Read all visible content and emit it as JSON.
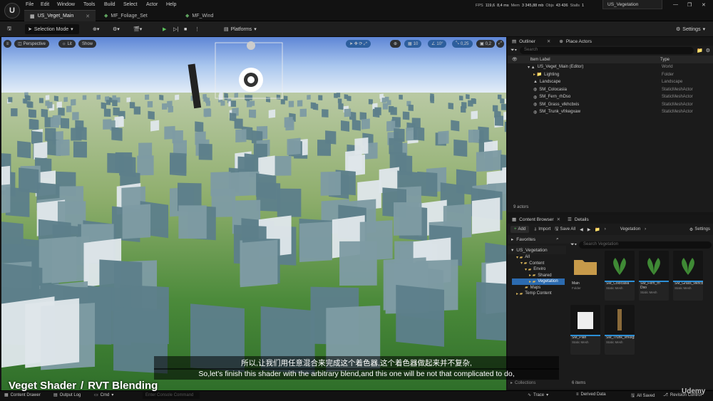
{
  "app": {
    "logo": "U",
    "menu": [
      "File",
      "Edit",
      "Window",
      "Tools",
      "Build",
      "Select",
      "Actor",
      "Help"
    ],
    "tabs": [
      "US_Veget_Main",
      "MF_Foliage_Set",
      "MF_Wind"
    ],
    "stats": {
      "fps_label": "FPS",
      "fps": "119,6",
      "ms": "8,4 ms",
      "mem_label": "Mem",
      "mem": "3 345,88 mb",
      "objs_label": "Objs",
      "objs": "43 436",
      "stalls_label": "Stalls",
      "stalls": "1"
    },
    "level_name": "US_Vegetation"
  },
  "toolbar": {
    "mode": "Selection Mode",
    "platforms": "Platforms",
    "settings": "Settings"
  },
  "viewport": {
    "perspective": "Perspective",
    "lit": "Lit",
    "show": "Show",
    "grid_snap": "10",
    "rot_snap": "10°",
    "scale_snap": "0,25",
    "cam_speed": "0,2"
  },
  "outliner": {
    "tab": "Outliner",
    "tab2": "Place Actors",
    "search_placeholder": "Search",
    "col_label": "Item Label",
    "col_type": "Type",
    "rows": [
      {
        "label": "US_Veget_Main (Editor)",
        "type": "World"
      },
      {
        "label": "Lighting",
        "type": "Folder"
      },
      {
        "label": "Landscape",
        "type": "Landscape"
      },
      {
        "label": "SM_Colocasia",
        "type": "StaticMeshActor"
      },
      {
        "label": "SM_Fern_rhDso",
        "type": "StaticMeshActor"
      },
      {
        "label": "SM_Grass_vlkhcbxis",
        "type": "StaticMeshActor"
      },
      {
        "label": "SM_Trunk_vfrkegxaw",
        "type": "StaticMeshActor"
      }
    ],
    "footer": "9 actors"
  },
  "content_browser": {
    "tab": "Content Browser",
    "tab2": "Details",
    "add": "Add",
    "import": "Import",
    "save_all": "Save All",
    "path": "Vegetation",
    "settings": "Settings",
    "favorites": "Favorites",
    "root": "US_Vegetation",
    "search_placeholder": "Search Vegetation",
    "tree": [
      "All",
      "Content",
      "Enviro",
      "Shared",
      "Vegetation",
      "Maps",
      "Temp Content"
    ],
    "assets": [
      {
        "name": "Main",
        "type": "Folder"
      },
      {
        "name": "SM_Colocasia",
        "type": "Static Mesh"
      },
      {
        "name": "SM_Fern_rh Dso",
        "type": "Static Mesh"
      },
      {
        "name": "SM_Grass_vlkhcbxis",
        "type": "Static Mesh"
      },
      {
        "name": "SM_Plan",
        "type": "Static Mesh"
      },
      {
        "name": "SM_Trunk_vfrkegxaw",
        "type": "Static Mesh"
      }
    ],
    "footer": "6 items",
    "collections": "Collections"
  },
  "bottom": {
    "content_drawer": "Content Drawer",
    "output_log": "Output Log",
    "cmd": "Cmd",
    "console_placeholder": "Enter Console Command",
    "trace": "Trace",
    "derived_data": "Derived Data",
    "all_saved": "All Saved",
    "revision_control": "Revision Control"
  },
  "overlay": {
    "subtitle_cn": "所以,让我们用任意混合来完成这个着色器,这个着色器做起来并不复杂,",
    "subtitle_en": "So,let's finish this shader with the arbitrary blend,and this one will be not that complicated to do,",
    "course_title_1": "Veget Shader",
    "course_title_2": "RVT Blending",
    "watermark": "Udemy"
  }
}
